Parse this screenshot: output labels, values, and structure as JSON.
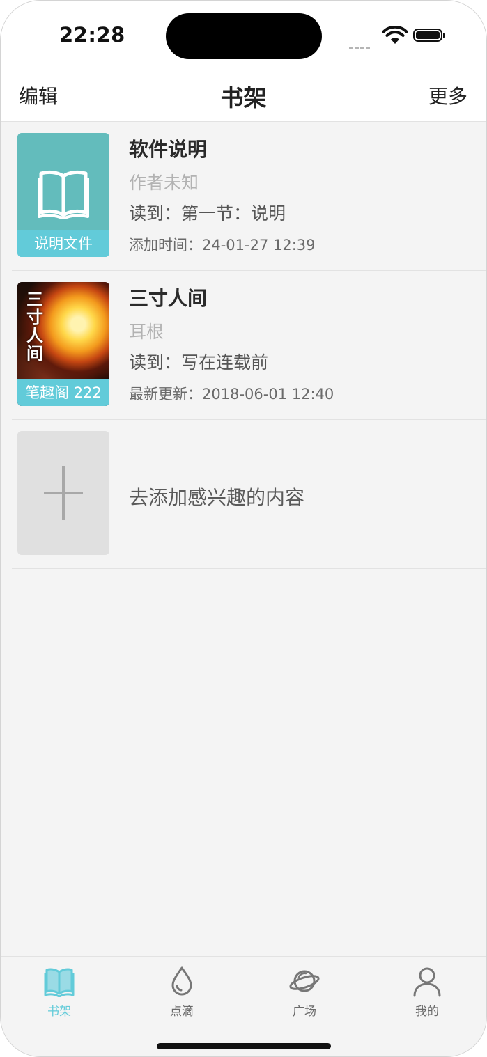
{
  "status_bar": {
    "time": "22:28",
    "icons": [
      "cellular-signal-icon",
      "wifi-icon",
      "battery-icon"
    ]
  },
  "nav": {
    "left": "编辑",
    "title": "书架",
    "right": "更多"
  },
  "books": [
    {
      "cover_label": "说明文件",
      "cover_icon": "open-book-icon",
      "title": "软件说明",
      "author": "作者未知",
      "progress": "读到：第一节：说明",
      "time": "添加时间：24-01-27 12:39"
    },
    {
      "cover_label": "笔趣阁 222",
      "cover_title": "三寸人间",
      "title": "三寸人间",
      "author": "耳根",
      "progress": "读到：写在连载前",
      "time": "最新更新：2018-06-01 12:40"
    }
  ],
  "add_item": {
    "icon": "plus-icon",
    "label": "去添加感兴趣的内容"
  },
  "tabs": [
    {
      "label": "书架",
      "icon": "bookshelf-icon",
      "active": true
    },
    {
      "label": "点滴",
      "icon": "droplet-icon",
      "active": false
    },
    {
      "label": "广场",
      "icon": "planet-icon",
      "active": false
    },
    {
      "label": "我的",
      "icon": "person-icon",
      "active": false
    }
  ],
  "colors": {
    "accent": "#62cbd9",
    "doc_cover": "#63bcbc",
    "background": "#f4f4f4"
  }
}
